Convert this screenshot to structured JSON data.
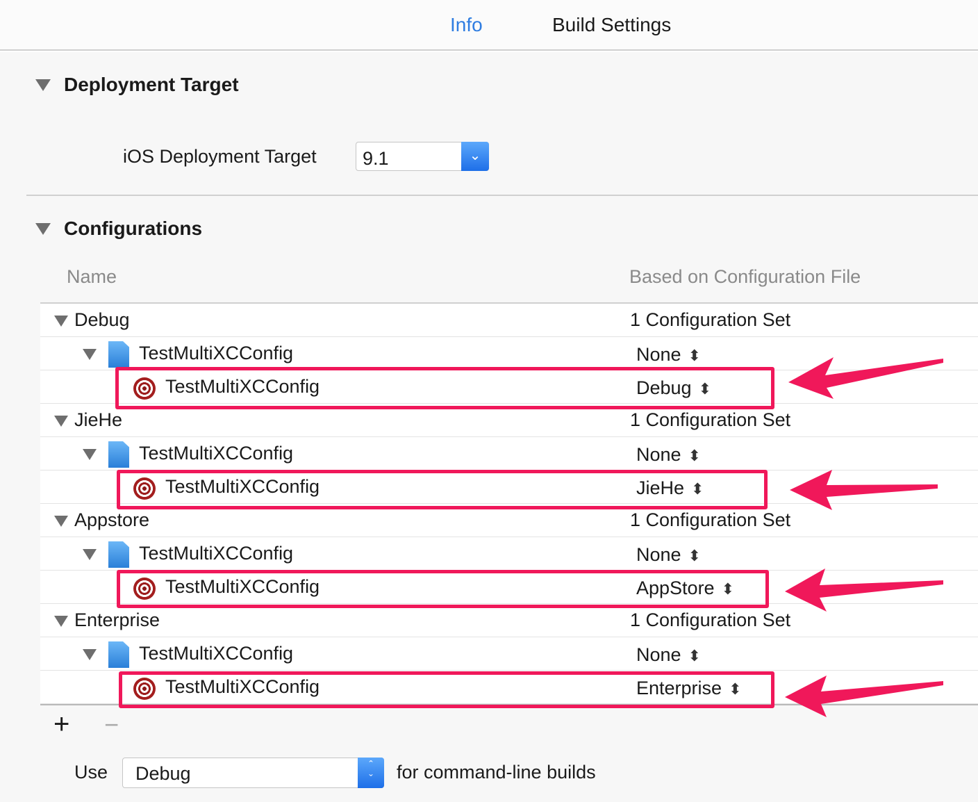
{
  "tabs": {
    "info": "Info",
    "build_settings": "Build Settings"
  },
  "deployment": {
    "title": "Deployment Target",
    "ios_label": "iOS Deployment Target",
    "ios_value": "9.1"
  },
  "configurations": {
    "title": "Configurations",
    "col_name": "Name",
    "col_based_on": "Based on Configuration File",
    "groups": [
      {
        "name": "Debug",
        "summary": "1 Configuration Set",
        "project": "TestMultiXCConfig",
        "project_value": "None",
        "target": "TestMultiXCConfig",
        "target_value": "Debug"
      },
      {
        "name": "JieHe",
        "summary": "1 Configuration Set",
        "project": "TestMultiXCConfig",
        "project_value": "None",
        "target": "TestMultiXCConfig",
        "target_value": "JieHe"
      },
      {
        "name": "Appstore",
        "summary": "1 Configuration Set",
        "project": "TestMultiXCConfig",
        "project_value": "None",
        "target": "TestMultiXCConfig",
        "target_value": "AppStore"
      },
      {
        "name": "Enterprise",
        "summary": "1 Configuration Set",
        "project": "TestMultiXCConfig",
        "project_value": "None",
        "target": "TestMultiXCConfig",
        "target_value": "Enterprise"
      }
    ],
    "add_label": "+",
    "remove_label": "−",
    "use_label": "Use",
    "use_value": "Debug",
    "use_suffix": "for command-line builds"
  },
  "colors": {
    "accent": "#1a73e8",
    "annotation": "#f0185a"
  }
}
